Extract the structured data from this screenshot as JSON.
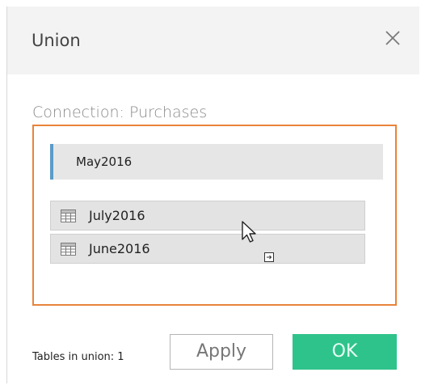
{
  "dialog": {
    "title": "Union",
    "close_icon": "close-icon"
  },
  "connection": {
    "label": "Connection: Purchases"
  },
  "union_tables": [
    {
      "label": "May2016"
    }
  ],
  "dragged_tables": [
    {
      "label": "July2016",
      "icon": "table-icon"
    },
    {
      "label": "June2016",
      "icon": "table-icon"
    }
  ],
  "footer": {
    "tables_in_union": "Tables in union: 1",
    "apply_label": "Apply",
    "ok_label": "OK"
  },
  "colors": {
    "accent_orange": "#e8833a",
    "accent_blue": "#5b9bc8",
    "ok_green": "#2fc38c"
  }
}
